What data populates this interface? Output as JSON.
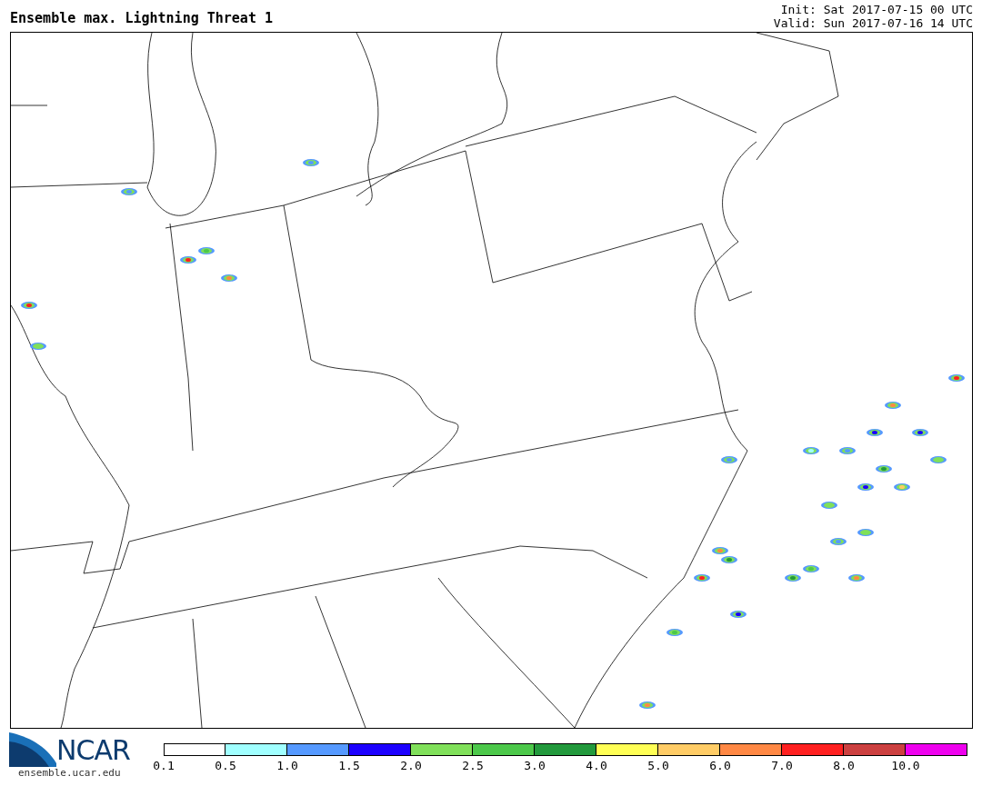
{
  "title": "Ensemble max. Lightning Threat 1",
  "init": "Init: Sat 2017-07-15 00 UTC",
  "valid": "Valid: Sun 2017-07-16 14 UTC",
  "logo": {
    "name": "NCAR",
    "url": "ensemble.ucar.edu"
  },
  "legend": [
    {
      "label": "0.1",
      "color": "#ffffff"
    },
    {
      "label": "0.5",
      "color": "#a0ffff"
    },
    {
      "label": "1.0",
      "color": "#5599ff"
    },
    {
      "label": "1.5",
      "color": "#1c00ff"
    },
    {
      "label": "2.0",
      "color": "#80e05a"
    },
    {
      "label": "2.5",
      "color": "#4cc84a"
    },
    {
      "label": "3.0",
      "color": "#22993c"
    },
    {
      "label": "4.0",
      "color": "#ffff55"
    },
    {
      "label": "5.0",
      "color": "#ffcc66"
    },
    {
      "label": "6.0",
      "color": "#ff8844"
    },
    {
      "label": "7.0",
      "color": "#ff2020"
    },
    {
      "label": "8.0",
      "color": "#cc4040"
    },
    {
      "label": "10.0",
      "color": "#ee00ee"
    }
  ]
}
